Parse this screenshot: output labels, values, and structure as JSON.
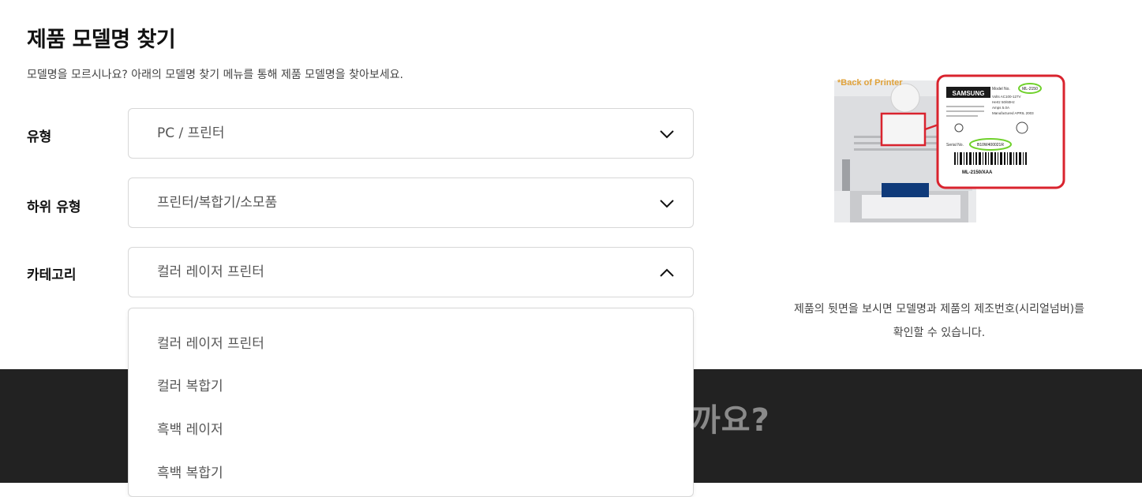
{
  "page": {
    "title": "제품 모델명 찾기",
    "subtitle": "모델명을 모르시나요? 아래의 모델명 찾기 메뉴를 통해 제품 모델명을 찾아보세요."
  },
  "filters": [
    {
      "label": "유형",
      "value": "PC / 프린터",
      "icon": "chevron-down-icon"
    },
    {
      "label": "하위 유형",
      "value": "프린터/복합기/소모품",
      "icon": "chevron-down-icon"
    },
    {
      "label": "카테고리",
      "value": "컬러 레이저 프린터",
      "icon": "chevron-up-icon"
    }
  ],
  "category_options": [
    "컬러 레이저 프린터",
    "컬러 복합기",
    "흑백 레이저",
    "흑백 복합기"
  ],
  "guide_image": {
    "back_label": "*Back of Printer",
    "brand": "SAMSUNG",
    "model_field": "Model No.",
    "model_value": "ML-2150",
    "serial_field": "Serial No.",
    "serial_value": "B10W400021R",
    "model_code": "ML-2150/XAA",
    "spec_lines": [
      "Volts AC100-127V",
      "Hertz 50/60Hz",
      "Amps 5.0A",
      "Manufactured APRIL 2003"
    ]
  },
  "guide_caption": {
    "line1": "제품의 뒷면을 보시면 모델명과 제품의 제조번호(시리얼넘버)를",
    "line2": "확인할 수 있습니다."
  },
  "footer": {
    "partial_heading": "까요?"
  },
  "colors": {
    "highlight_red": "#d9232e",
    "highlight_green": "#6fd12b",
    "footer_bg": "#222222",
    "border": "#d7d7d7"
  }
}
